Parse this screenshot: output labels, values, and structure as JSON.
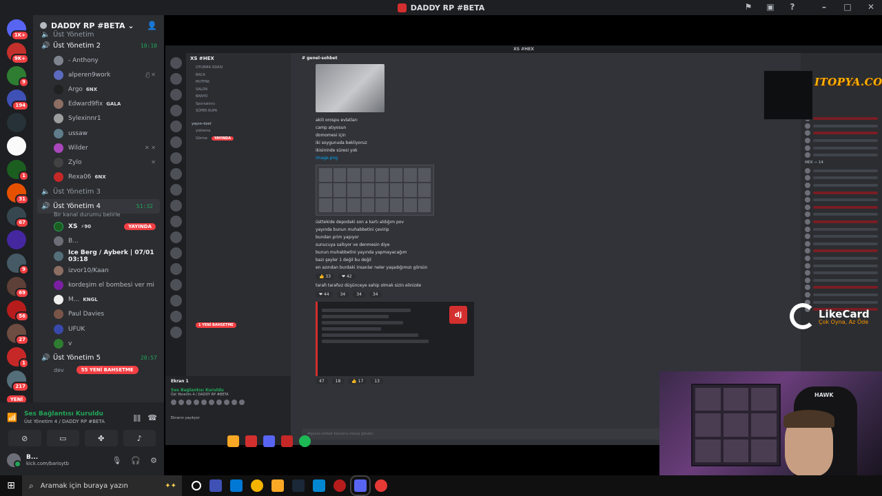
{
  "window": {
    "title": "DADDY RP #BETA"
  },
  "server": {
    "name": "DADDY RP #BETA"
  },
  "guild_badges": [
    "1K+",
    "9K+",
    "9",
    "194",
    "",
    "",
    "1",
    "31",
    "67",
    "",
    "9",
    "69",
    "56",
    "27",
    "1",
    "217"
  ],
  "guild_new_label": "YENİ",
  "channels": {
    "partial_top": "Üst Yönetim",
    "ch2": {
      "name": "Üst Yönetim 2",
      "time": "10:10"
    },
    "ch2_users": [
      {
        "name": "- Anthony",
        "tag": ""
      },
      {
        "name": "alperen9work",
        "tag": ""
      },
      {
        "name": "Argo",
        "tag": "6NX"
      },
      {
        "name": "Edward9fix",
        "tag": "GALA"
      },
      {
        "name": "Sylexinnr1",
        "tag": ""
      },
      {
        "name": "ussaw",
        "tag": ""
      },
      {
        "name": "Wilder",
        "tag": ""
      },
      {
        "name": "Zylo",
        "tag": ""
      },
      {
        "name": "Rexa06",
        "tag": "6NX"
      }
    ],
    "ch3": {
      "name": "Üst Yönetim 3"
    },
    "ch4": {
      "name": "Üst Yönetim 4",
      "time": "51:32",
      "status": "Bir kanal durumu belirle"
    },
    "ch4_users": [
      {
        "name": "XS",
        "tag": "⚡90",
        "live": "YAYINDA"
      },
      {
        "name": "B...",
        "tag": ""
      },
      {
        "name": "Ice Berg / Ayberk | 07/01 03:18",
        "tag": ""
      },
      {
        "name": "izvor10/Kaan",
        "tag": ""
      },
      {
        "name": "kordeşim el bombesi ver mi",
        "tag": ""
      },
      {
        "name": "M...",
        "tag": "KNGL"
      },
      {
        "name": "Paul Davies",
        "tag": ""
      },
      {
        "name": "UFUK",
        "tag": ""
      },
      {
        "name": "v",
        "tag": ""
      }
    ],
    "ch5": {
      "name": "Üst Yönetim 5",
      "time": "20:57",
      "sub": "dev",
      "mention_pill": "55 YENİ BAHSETME"
    }
  },
  "voice": {
    "status": "Ses Bağlantısı Kuruldu",
    "location": "Üst Yönetim 4 / DADDY RP #BETA"
  },
  "user_panel": {
    "name": "B...",
    "link": "kick.com/barisytb"
  },
  "stream": {
    "inner_title": "XS #HEX",
    "inner_server": "XS #HEX",
    "inner_channel": "genel-sohbet",
    "inner_channels": [
      "OTURMA ODASI",
      "BACA",
      "MUTFAK",
      "SALON",
      "BANYO",
      "Sporsalonu",
      "SÜPER KUPA",
      "yayın-özel",
      "yoklama",
      "Görme"
    ],
    "inner_live": "YAYINDA",
    "inner_pill": "1 YENİ BAHSETME",
    "inner_voice_ekran": "Ekran 1",
    "inner_voice_status": "Ses Bağlantısı Kuruldu",
    "inner_voice_sub": "Üst Yönetim 4 / DADDY RP #BETA",
    "inner_voice_foot": "Ekranın yayılıyor",
    "messages": [
      "akili orospu evlatları",
      "camp atıyosun",
      "domomesi için",
      "iki soygunuda bekliyoruz",
      "ikisininde süresi yok"
    ],
    "link": "image.png",
    "messages2": [
      "üsttekide depodaki son a kartı aldığım pov",
      "yayında bunun muhabbetini çevirip",
      "bundan prim yapıyor",
      "sunucuya sallıyor ve denmesin diye",
      "bunun muhabbetini yayında yapmayacağım",
      "bazı şeyler 1 değil bu değil",
      "en azından burdaki insanlar neler yaşadığımızı görsün",
      "tarafı tarafsız düşünceye sahip olmak sizin elinizde"
    ],
    "reacts1": [
      "👍 33",
      "❤ 42"
    ],
    "reacts2": [
      "❤ 44",
      "34",
      "34",
      "34"
    ],
    "reacts3": [
      "47",
      "18",
      "👍 17",
      "13"
    ],
    "input_placeholder": "#genel-sohbet kanalına mesaj gönder",
    "watermark": "ITOPYA.COM",
    "sponsor": {
      "name": "LikeCard",
      "tagline": "Çok Oyna, Az Öde"
    },
    "webcam_label": "HAWK",
    "members_category": "HEX — 14",
    "embed_logo": "dj"
  },
  "taskbar": {
    "search_placeholder": "Aramak için buraya yazın"
  }
}
